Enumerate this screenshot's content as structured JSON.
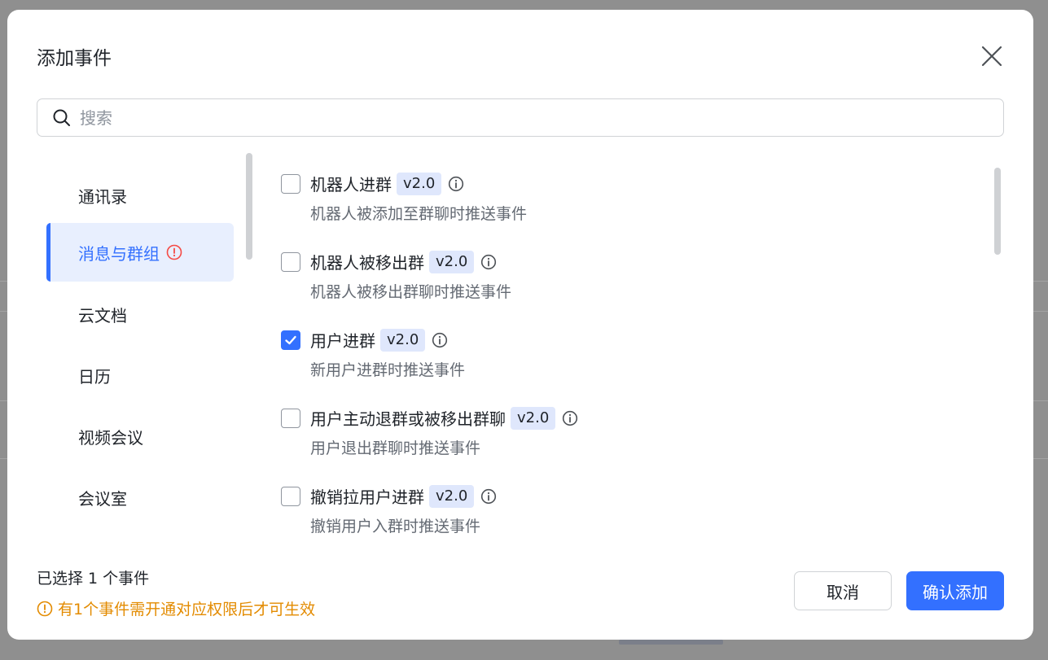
{
  "modal": {
    "title": "添加事件"
  },
  "search": {
    "placeholder": "搜索"
  },
  "sidebar": {
    "items": [
      {
        "label": "通讯录",
        "active": false
      },
      {
        "label": "消息与群组",
        "active": true,
        "has_alert": true
      },
      {
        "label": "云文档",
        "active": false
      },
      {
        "label": "日历",
        "active": false
      },
      {
        "label": "视频会议",
        "active": false
      },
      {
        "label": "会议室",
        "active": false
      }
    ]
  },
  "events": [
    {
      "name": "机器人进群",
      "version": "v2.0",
      "description": "机器人被添加至群聊时推送事件",
      "checked": false
    },
    {
      "name": "机器人被移出群",
      "version": "v2.0",
      "description": "机器人被移出群聊时推送事件",
      "checked": false
    },
    {
      "name": "用户进群",
      "version": "v2.0",
      "description": "新用户进群时推送事件",
      "checked": true
    },
    {
      "name": "用户主动退群或被移出群聊",
      "version": "v2.0",
      "description": "用户退出群聊时推送事件",
      "checked": false
    },
    {
      "name": "撤销拉用户进群",
      "version": "v2.0",
      "description": "撤销用户入群时推送事件",
      "checked": false
    }
  ],
  "footer": {
    "selected_text": "已选择 1 个事件",
    "warning_text": "有1个事件需开通对应权限后才可生效",
    "cancel_label": "取消",
    "confirm_label": "确认添加"
  },
  "colors": {
    "accent": "#3370ff",
    "warning": "#e38b00",
    "alert": "#f54a45",
    "active_bg": "#e8effe",
    "tag_bg": "#dfe7fc"
  }
}
